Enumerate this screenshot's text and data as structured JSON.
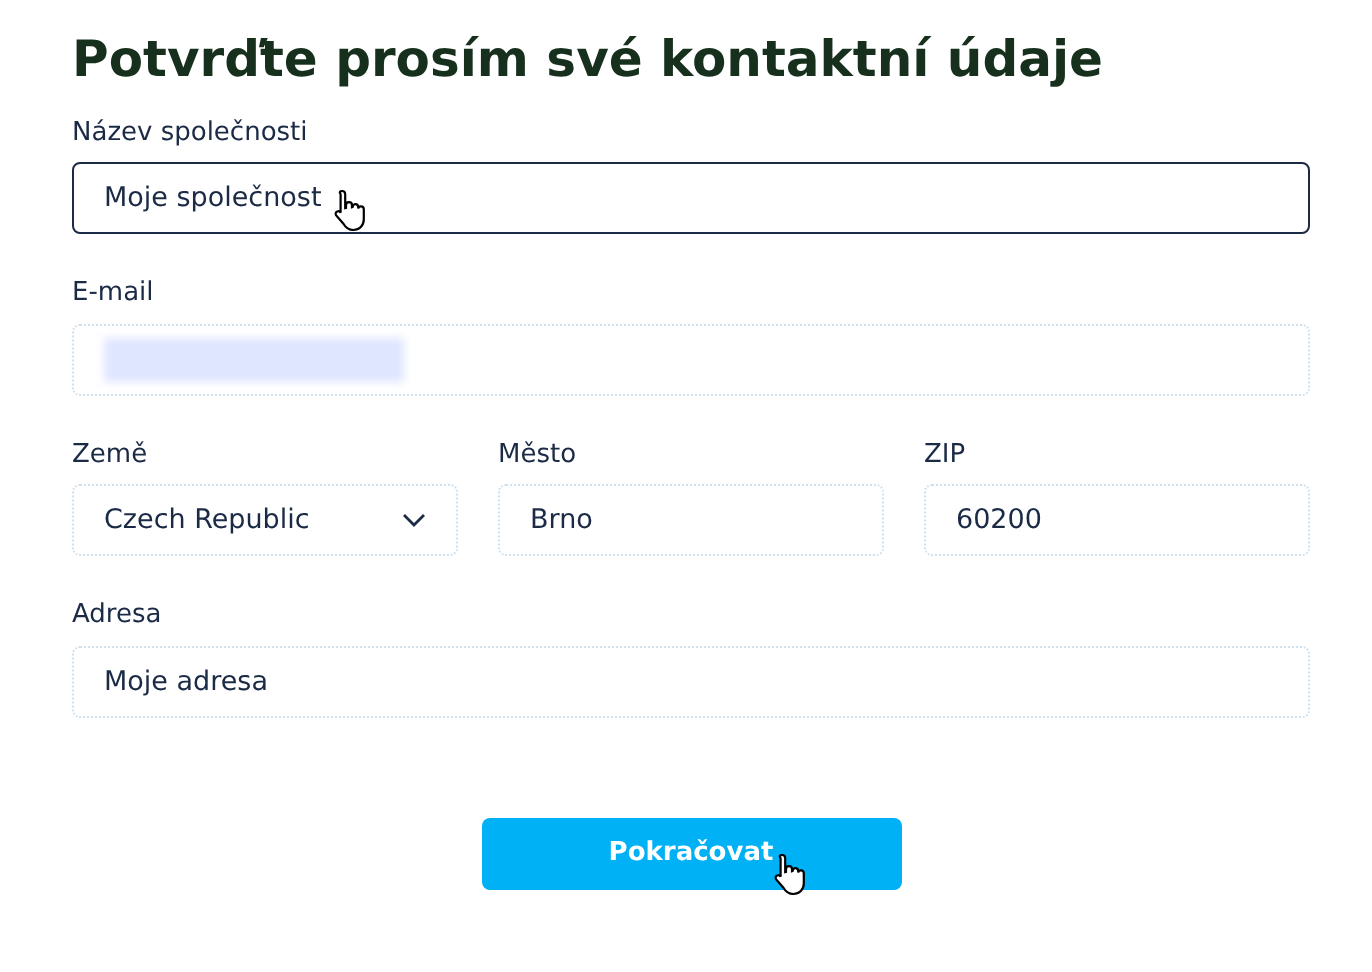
{
  "title": "Potvrďte prosím své kontaktní údaje",
  "rows": [
    [
      {
        "kind": "text",
        "label": "Název společnosti",
        "value": "Moje společnost",
        "focused": true,
        "cursor": true
      }
    ],
    [
      {
        "kind": "text",
        "label": "E-mail",
        "focused": false,
        "redacted": true
      }
    ],
    [
      {
        "kind": "select",
        "label": "Země",
        "value": "Czech Republic",
        "focused": false
      },
      {
        "kind": "text",
        "label": "Město",
        "value": "Brno",
        "focused": false
      },
      {
        "kind": "text",
        "label": "ZIP",
        "value": "60200",
        "focused": false
      }
    ],
    [
      {
        "kind": "text",
        "label": "Adresa",
        "value": "Moje adresa",
        "focused": false
      }
    ]
  ],
  "button": {
    "label": "Pokračovat",
    "cursor": true
  }
}
